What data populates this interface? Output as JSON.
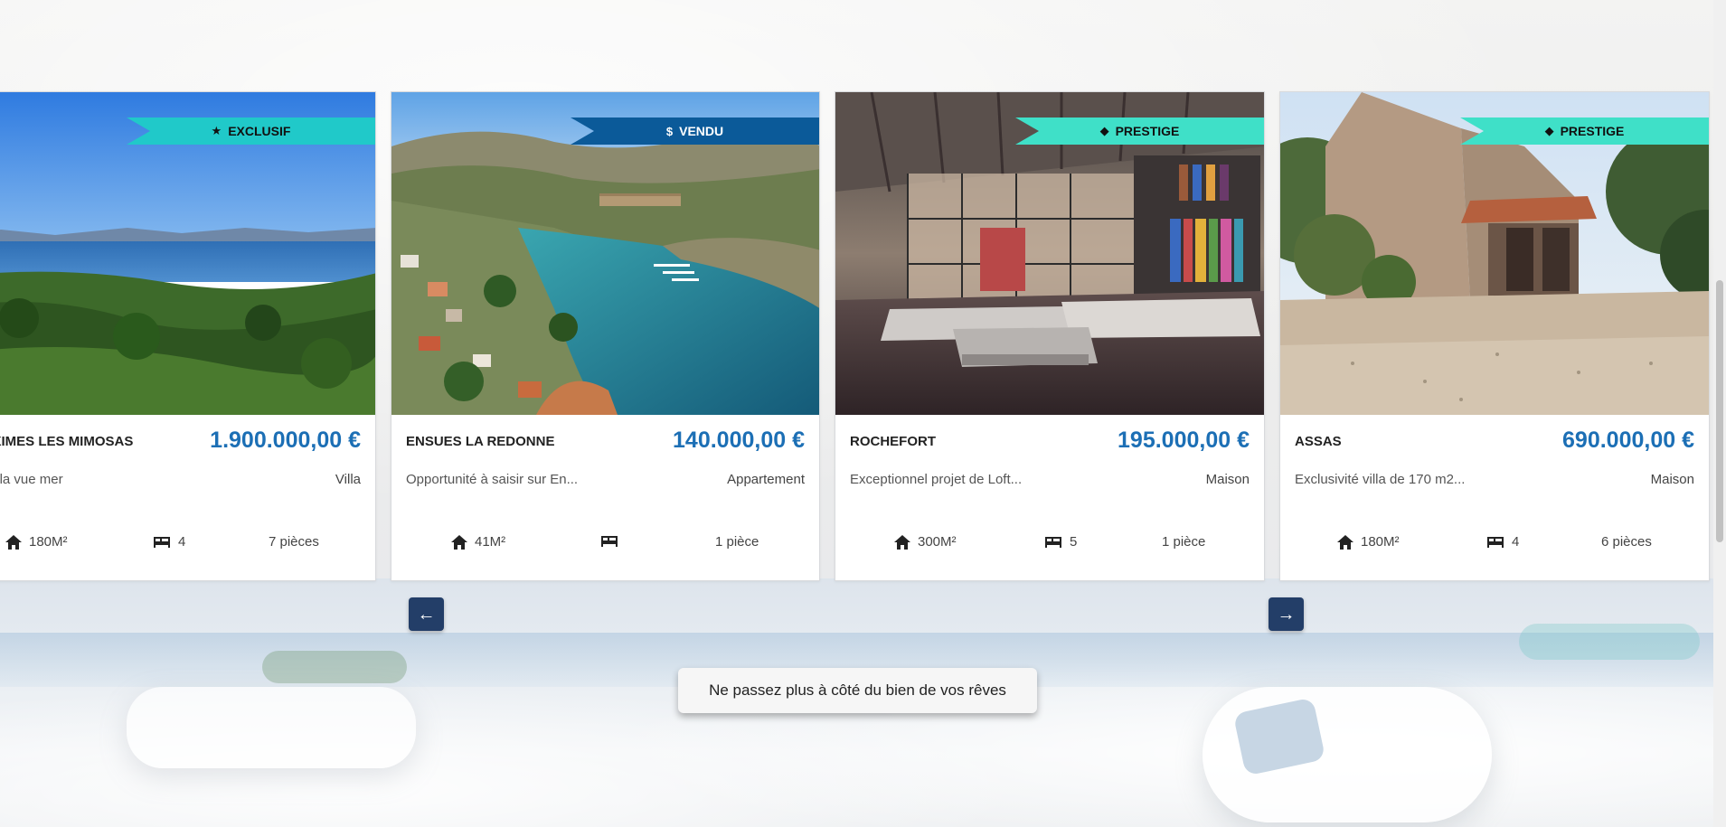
{
  "listings": [
    {
      "badge": "EXCLUSIF",
      "badge_icon": "star-icon",
      "badge_color": "#20c9c9",
      "city": "SAINTES MAXIMES LES MIMOSAS",
      "price": "1.900.000,00 €",
      "description": "Exclusivité - Villa vue mer",
      "type": "Villa",
      "surface": "180M²",
      "bedrooms": "4",
      "rooms": "7 pièces"
    },
    {
      "badge": "VENDU",
      "badge_icon": "dollar-icon",
      "badge_color": "#0b5a99",
      "city": "ENSUES LA REDONNE",
      "price": "140.000,00 €",
      "description": "Opportunité à saisir sur En...",
      "type": "Appartement",
      "surface": "41M²",
      "bedrooms": "",
      "rooms": "1 pièce"
    },
    {
      "badge": "PRESTIGE",
      "badge_icon": "diamond-icon",
      "badge_color": "#3fe0c8",
      "city": "ROCHEFORT",
      "price": "195.000,00 €",
      "description": "Exceptionnel projet de Loft...",
      "type": "Maison",
      "surface": "300M²",
      "bedrooms": "5",
      "rooms": "1 pièce"
    },
    {
      "badge": "PRESTIGE",
      "badge_icon": "diamond-icon",
      "badge_color": "#3fe0c8",
      "city": "ASSAS",
      "price": "690.000,00 €",
      "description": "Exclusivité villa de 170 m2...",
      "type": "Maison",
      "surface": "180M²",
      "bedrooms": "4",
      "rooms": "6 pièces"
    }
  ],
  "nav": {
    "prev_icon": "arrow-left-icon",
    "next_icon": "arrow-right-icon",
    "prev_glyph": "←",
    "next_glyph": "→"
  },
  "tagline": "Ne passez plus à côté du bien de vos rêves",
  "colors": {
    "price": "#1c6fb5",
    "nav_button": "#233e68"
  }
}
